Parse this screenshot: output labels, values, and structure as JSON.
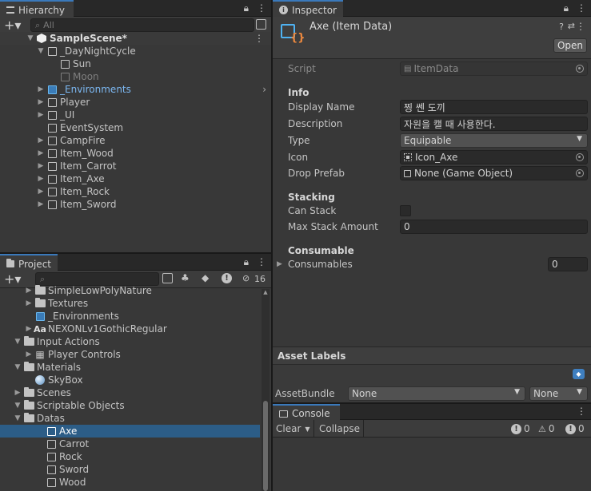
{
  "hierarchy": {
    "tab_label": "Hierarchy",
    "search_placeholder": "All",
    "scene_name": "SampleScene*",
    "items": [
      {
        "label": "_DayNightCycle"
      },
      {
        "label": "Sun"
      },
      {
        "label": "Moon"
      },
      {
        "label": "_Environments"
      },
      {
        "label": "Player"
      },
      {
        "label": "_UI"
      },
      {
        "label": "EventSystem"
      },
      {
        "label": "CampFire"
      },
      {
        "label": "Item_Wood"
      },
      {
        "label": "Item_Carrot"
      },
      {
        "label": "Item_Axe"
      },
      {
        "label": "Item_Rock"
      },
      {
        "label": "Item_Sword"
      }
    ]
  },
  "project": {
    "tab_label": "Project",
    "hidden_count": "16",
    "items": [
      {
        "label": "SimpleLowPolyNature"
      },
      {
        "label": "Textures"
      },
      {
        "label": "_Environments"
      },
      {
        "label": "NEXONLv1GothicRegular"
      },
      {
        "label": "Input Actions"
      },
      {
        "label": "Player Controls"
      },
      {
        "label": "Materials"
      },
      {
        "label": "SkyBox"
      },
      {
        "label": "Scenes"
      },
      {
        "label": "Scriptable Objects"
      },
      {
        "label": "Datas"
      },
      {
        "label": "Axe"
      },
      {
        "label": "Carrot"
      },
      {
        "label": "Rock"
      },
      {
        "label": "Sword"
      },
      {
        "label": "Wood"
      }
    ],
    "font_asset_prefix": "Aa"
  },
  "inspector": {
    "tab_label": "Inspector",
    "object_title": "Axe (Item Data)",
    "open_button": "Open",
    "script_label": "Script",
    "script_value": "ItemData",
    "info_header": "Info",
    "display_name_label": "Display Name",
    "display_name_value": "찡 쎈 도끼",
    "description_label": "Description",
    "description_value": "자원을 캘 때 사용한다.",
    "type_label": "Type",
    "type_value": "Equipable",
    "icon_label": "Icon",
    "icon_value": "Icon_Axe",
    "drop_prefab_label": "Drop Prefab",
    "drop_prefab_value": "None (Game Object)",
    "stacking_header": "Stacking",
    "can_stack_label": "Can Stack",
    "max_stack_label": "Max Stack Amount",
    "max_stack_value": "0",
    "consumable_header": "Consumable",
    "consumables_label": "Consumables",
    "consumables_value": "0",
    "asset_labels_header": "Asset Labels",
    "asset_bundle_label": "AssetBundle",
    "asset_bundle_value": "None",
    "asset_variant_value": "None"
  },
  "console": {
    "tab_label": "Console",
    "clear_label": "Clear",
    "collapse_label": "Collapse",
    "log_count": "0",
    "warn_count": "0",
    "error_count": "0"
  },
  "colors": {
    "selection": "#2c5d87",
    "tab_accent": "#3a79bb",
    "panel_bg": "#383838"
  }
}
